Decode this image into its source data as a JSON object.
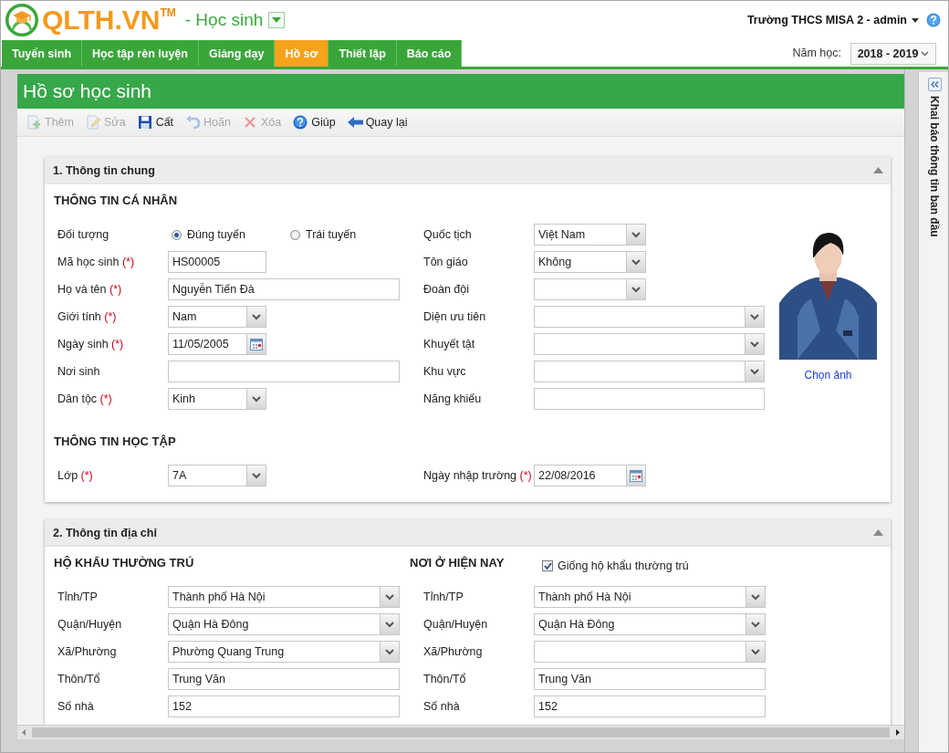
{
  "header": {
    "logo": "QLTH.VN",
    "trademark": "TM",
    "module": "- Học sinh",
    "account": "Trường THCS MISA 2 - admin"
  },
  "nav_tabs": [
    {
      "label": "Tuyển sinh",
      "selected": false
    },
    {
      "label": "Học tập rèn luyện",
      "selected": false
    },
    {
      "label": "Giảng dạy",
      "selected": false
    },
    {
      "label": "Hồ sơ",
      "selected": true
    },
    {
      "label": "Thiết lập",
      "selected": false
    },
    {
      "label": "Báo cáo",
      "selected": false
    }
  ],
  "school_year": {
    "label": "Năm học:",
    "value": "2018 - 2019"
  },
  "page_title": "Hồ sơ học sinh",
  "toolbar": [
    {
      "kind": "add",
      "label": "Thêm",
      "disabled": true
    },
    {
      "kind": "edit",
      "label": "Sửa",
      "disabled": true
    },
    {
      "kind": "save",
      "label": "Cất",
      "disabled": false
    },
    {
      "kind": "undo",
      "label": "Hoãn",
      "disabled": true
    },
    {
      "kind": "delete",
      "label": "Xóa",
      "disabled": true
    },
    {
      "kind": "help",
      "label": "Giúp",
      "disabled": false
    },
    {
      "kind": "back",
      "label": "Quay lại",
      "disabled": false
    }
  ],
  "general_info": {
    "title": "1. Thông tin chung",
    "expanded": true,
    "personal_heading": "THÔNG TIN CÁ NHÂN",
    "left_fields": [
      {
        "kind": "radio",
        "label": "Đối tượng",
        "options": [
          {
            "label": "Đúng tuyến",
            "selected": true
          },
          {
            "label": "Trái tuyến",
            "selected": false
          }
        ]
      },
      {
        "kind": "text",
        "label": "Mã học sinh",
        "mark": "(*)",
        "value": "HS00005"
      },
      {
        "kind": "text",
        "label": "Họ và tên",
        "mark": "(*)",
        "value": "Nguyễn Tiến Đà"
      },
      {
        "kind": "select",
        "label": "Giới tính",
        "mark": "(*)",
        "value": "Nam"
      },
      {
        "kind": "date",
        "label": "Ngày sinh",
        "mark": "(*)",
        "value": "11/05/2005"
      },
      {
        "kind": "text",
        "label": "Nơi sinh"
      },
      {
        "kind": "select",
        "label": "Dân tộc",
        "mark": "(*)",
        "value": "Kinh"
      }
    ],
    "right_fields": [
      {
        "kind": "select",
        "label": "Quốc tịch",
        "value": "Việt Nam"
      },
      {
        "kind": "select",
        "label": "Tôn giáo",
        "value": "Không"
      },
      {
        "kind": "select",
        "label": "Đoàn đội"
      },
      {
        "kind": "select",
        "label": "Diện ưu tiên"
      },
      {
        "kind": "select",
        "label": "Khuyết tật"
      },
      {
        "kind": "select",
        "label": "Khu vực"
      },
      {
        "kind": "text",
        "label": "Năng khiếu"
      }
    ],
    "photo": {
      "kind": "picture",
      "link": "Chọn ảnh"
    },
    "study_heading": "THÔNG TIN HỌC TẬP",
    "study_left": [
      {
        "kind": "select",
        "label": "Lớp",
        "mark": "(*)",
        "value": "7A"
      }
    ],
    "study_right": [
      {
        "kind": "date",
        "label": "Ngày nhập trường",
        "mark": "(*)",
        "value": "22/08/2016"
      }
    ]
  },
  "address_info": {
    "title": "2. Thông tin địa chỉ",
    "expanded": true,
    "permanent": {
      "heading": "HỘ KHẨU THƯỜNG TRÚ",
      "fields": [
        {
          "kind": "select",
          "label": "Tỉnh/TP",
          "value": "Thành phố Hà Nội"
        },
        {
          "kind": "select",
          "label": "Quận/Huyện",
          "value": "Quận Hà Đông"
        },
        {
          "kind": "select",
          "label": "Xã/Phường",
          "value": "Phường Quang Trung"
        },
        {
          "kind": "text",
          "label": "Thôn/Tổ",
          "value": "Trung Văn"
        },
        {
          "kind": "text",
          "label": "Số nhà",
          "value": "152"
        }
      ]
    },
    "current": {
      "heading": "NƠI Ở HIỆN NAY",
      "same_as": {
        "label": "Giống hộ khẩu thường trú",
        "checked": true
      },
      "fields": [
        {
          "kind": "select",
          "label": "Tỉnh/TP",
          "value": "Thành phố Hà Nội"
        },
        {
          "kind": "select",
          "label": "Quận/Huyện",
          "value": "Quận Hà Đông"
        },
        {
          "kind": "select",
          "label": "Xã/Phường"
        },
        {
          "kind": "text",
          "label": "Thôn/Tổ",
          "value": "Trung Văn"
        },
        {
          "kind": "text",
          "label": "Số nhà",
          "value": "152"
        }
      ]
    }
  },
  "side_panel": {
    "title": "Khai báo thông tin ban đầu"
  }
}
